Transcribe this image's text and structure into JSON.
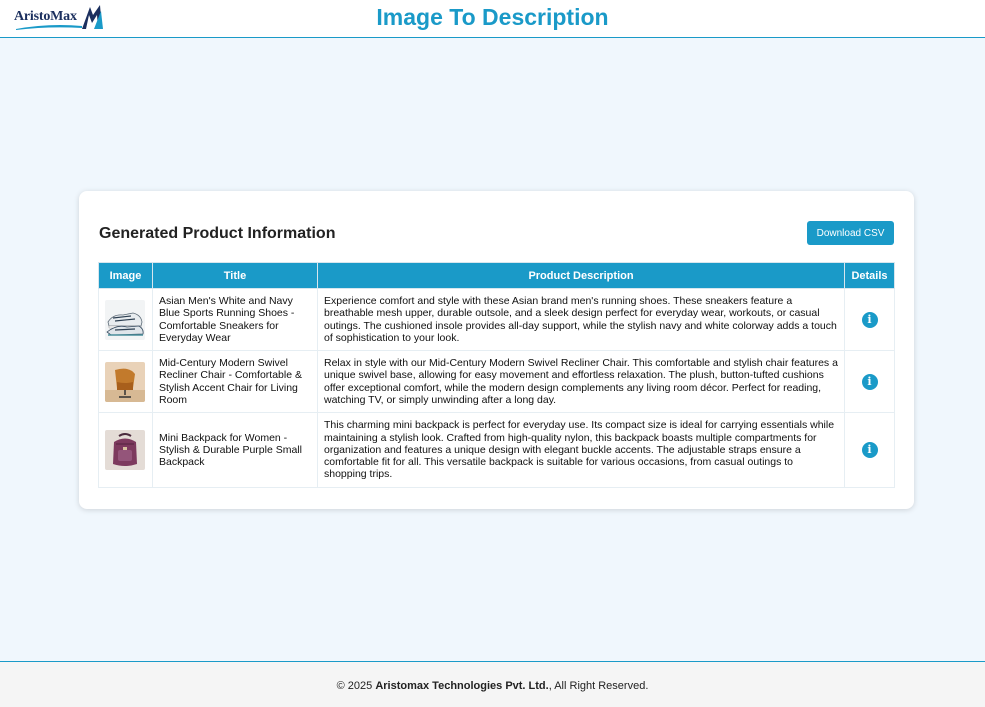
{
  "header": {
    "logo_text": "AristoMax",
    "title": "Image To Description"
  },
  "card": {
    "title": "Generated Product Information",
    "download_label": "Download CSV"
  },
  "table": {
    "columns": [
      "Image",
      "Title",
      "Product Description",
      "Details"
    ],
    "rows": [
      {
        "title": "Asian Men's White and Navy Blue Sports Running Shoes - Comfortable Sneakers for Everyday Wear",
        "description": "Experience comfort and style with these Asian brand men's running shoes. These sneakers feature a breathable mesh upper, durable outsole, and a sleek design perfect for everyday wear, workouts, or casual outings. The cushioned insole provides all-day support, while the stylish navy and white colorway adds a touch of sophistication to your look.",
        "image_icon": "sneaker-image"
      },
      {
        "title": "Mid-Century Modern Swivel Recliner Chair - Comfortable & Stylish Accent Chair for Living Room",
        "description": "Relax in style with our Mid-Century Modern Swivel Recliner Chair. This comfortable and stylish chair features a unique swivel base, allowing for easy movement and effortless relaxation. The plush, button-tufted cushions offer exceptional comfort, while the modern design complements any living room décor. Perfect for reading, watching TV, or simply unwinding after a long day.",
        "image_icon": "chair-image"
      },
      {
        "title": "Mini Backpack for Women - Stylish & Durable Purple Small Backpack",
        "description": "This charming mini backpack is perfect for everyday use. Its compact size is ideal for carrying essentials while maintaining a stylish look. Crafted from high-quality nylon, this backpack boasts multiple compartments for organization and features a unique design with elegant buckle accents. The adjustable straps ensure a comfortable fit for all. This versatile backpack is suitable for various occasions, from casual outings to shopping trips.",
        "image_icon": "backpack-image"
      }
    ],
    "details_icon": "info-icon"
  },
  "footer": {
    "prefix": "© 2025 ",
    "company": "Aristomax Technologies Pvt. Ltd.",
    "suffix": ", All Right Reserved."
  },
  "colors": {
    "accent": "#1a9ac8",
    "background": "#f0f7fd"
  }
}
